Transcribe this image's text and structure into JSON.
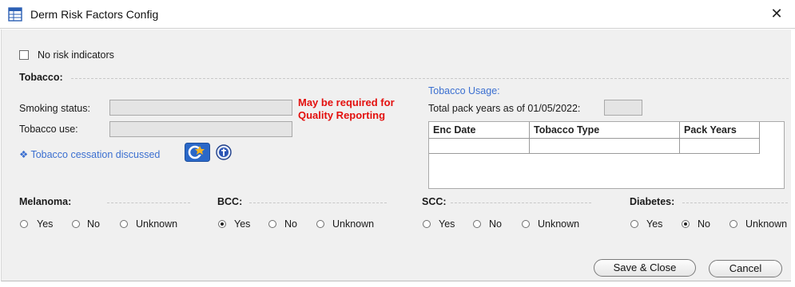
{
  "window": {
    "title": "Derm Risk Factors Config",
    "close_glyph": "✕"
  },
  "no_risk": {
    "label": "No risk indicators",
    "checked": false
  },
  "tobacco": {
    "section_label": "Tobacco:",
    "smoking_status_label": "Smoking status:",
    "smoking_status_value": "",
    "tobacco_use_label": "Tobacco use:",
    "tobacco_use_value": "",
    "warning_line1": "May be required for",
    "warning_line2": "Quality Reporting",
    "cessation_link": "❖ Tobacco cessation discussed",
    "usage_title": "Tobacco Usage:",
    "pack_years_label": "Total pack years as of 01/05/2022:",
    "pack_years_value": "",
    "grid": {
      "columns": [
        "Enc Date",
        "Tobacco Type",
        "Pack Years"
      ],
      "rows": []
    }
  },
  "conditions": [
    {
      "label": "Melanoma:",
      "options": [
        "Yes",
        "No",
        "Unknown"
      ],
      "selected": null
    },
    {
      "label": "BCC:",
      "options": [
        "Yes",
        "No",
        "Unknown"
      ],
      "selected": "Yes"
    },
    {
      "label": "SCC:",
      "options": [
        "Yes",
        "No",
        "Unknown"
      ],
      "selected": null
    },
    {
      "label": "Diabetes:",
      "options": [
        "Yes",
        "No",
        "Unknown"
      ],
      "selected": "No"
    }
  ],
  "buttons": {
    "save_close": "Save & Close",
    "cancel": "Cancel"
  },
  "colors": {
    "warning": "#e3100e",
    "link": "#3b6fd0",
    "dialog_bg": "#f0f0f0"
  }
}
